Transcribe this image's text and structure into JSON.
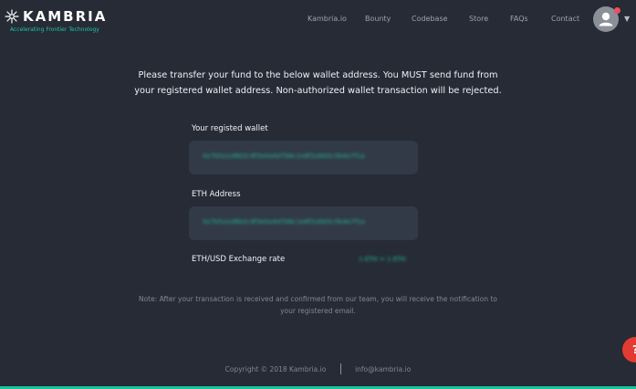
{
  "brand": {
    "name": "KAMBRIA",
    "tagline": "Accelerating Frontier Technology"
  },
  "nav": {
    "items": [
      "Kambria.io",
      "Bounty",
      "Codebase",
      "Store",
      "FAQs",
      "Contact"
    ]
  },
  "intro": {
    "text": "Please transfer your fund to the below wallet address. You MUST send fund from your registered wallet address. Non-authorized wallet transaction will be rejected."
  },
  "fields": {
    "wallet_label": "Your registed wallet",
    "wallet_value": "0x7b5a1d8b2c9f3e0a4d7b6c1e8f2a9d3c5b4e7f1a",
    "eth_label": "ETH Address",
    "eth_value": "0x7b5a1d8b2c9f3e0a4d7b6c1e8f2a9d3c5b4e7f1a",
    "rate_label": "ETH/USD Exchange rate",
    "rate_value": "1 ETH = 1 ETH"
  },
  "note": {
    "text": "Note: After your transaction is received and confirmed from our team, you will receive the notification to your registered email."
  },
  "footer": {
    "copyright": "Copyright © 2018 Kambria.io",
    "email": "info@kambria.io"
  },
  "help": {
    "label": "?"
  },
  "colors": {
    "background": "#262b36",
    "accent": "#15c79b",
    "field_background": "#323947",
    "notification": "#f04e5e"
  }
}
